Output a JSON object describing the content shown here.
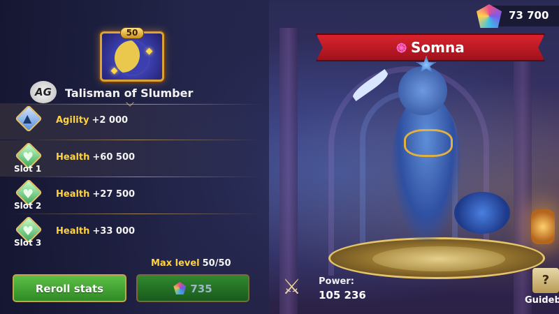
{
  "talisman": {
    "level": "50",
    "logo_text": "AG",
    "title": "Talisman of Slumber"
  },
  "stats": [
    {
      "name": "Agility",
      "value": "+2 000",
      "slot": ""
    },
    {
      "name": "Health",
      "value": "+60 500",
      "slot": "Slot 1"
    },
    {
      "name": "Health",
      "value": "+27 500",
      "slot": "Slot 2"
    },
    {
      "name": "Health",
      "value": "+33 000",
      "slot": "Slot 3"
    }
  ],
  "max_level": {
    "label": "Max level",
    "value": "50/50"
  },
  "buttons": {
    "reroll_label": "Reroll stats",
    "cost_value": "735"
  },
  "hero": {
    "name": "Somna"
  },
  "currency": {
    "gems": "73 700"
  },
  "power": {
    "label": "Power:",
    "value": "105 236"
  },
  "guidebook": {
    "label": "Guidebook"
  },
  "icons": {
    "talisman": "talisman-moon-icon",
    "agility": "agility-diamond-icon",
    "health": "health-heart-icon",
    "gem": "gem-icon",
    "power": "crossed-swords-icon",
    "guidebook": "book-question-icon",
    "hero_element": "swirl-element-icon",
    "hero_star": "star-badge-icon"
  },
  "colors": {
    "stat_name": "#ffd23f",
    "reroll_button": "#4aa83a",
    "banner": "#c41d27"
  }
}
